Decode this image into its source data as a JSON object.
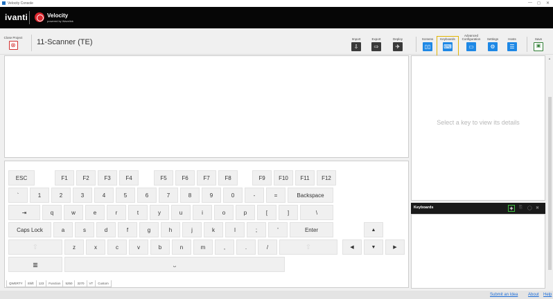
{
  "window": {
    "title": "Velocity Console",
    "controls": [
      "—",
      "◻",
      "✕"
    ]
  },
  "brand": {
    "vendor": "ivanti",
    "product": "Velocity",
    "subtitle": "powered by Wavelink"
  },
  "toolbar": {
    "close_project": "Close Project",
    "project_title": "11-Scanner (TE)",
    "buttons": {
      "import": "Import",
      "export": "Export",
      "deploy": "Deploy",
      "screens": "Screens",
      "keyboards": "Keyboards",
      "advanced_configuration": "Advanced\nConfiguration",
      "settings": "Settings",
      "hosts": "Hosts",
      "save": "Save"
    },
    "selected": "keyboards",
    "colors": {
      "accent_blue": "#1e88e5",
      "selected_outline": "#e0b400",
      "save_green": "#2e7d32"
    }
  },
  "details": {
    "message": "Select a key to view its details"
  },
  "keyboard": {
    "row1": [
      "ESC",
      "F1",
      "F2",
      "F3",
      "F4",
      "F5",
      "F6",
      "F7",
      "F8",
      "F9",
      "F10",
      "F11",
      "F12"
    ],
    "row2": [
      "`",
      "1",
      "2",
      "3",
      "4",
      "5",
      "6",
      "7",
      "8",
      "9",
      "0",
      "-",
      "=",
      "Backspace"
    ],
    "row3": [
      "⇥",
      "q",
      "w",
      "e",
      "r",
      "t",
      "y",
      "u",
      "i",
      "o",
      "p",
      "[",
      "]",
      "\\"
    ],
    "row4": [
      "Caps Lock",
      "a",
      "s",
      "d",
      "f",
      "g",
      "h",
      "j",
      "k",
      "l",
      ";",
      "'",
      "Enter",
      "▲"
    ],
    "row5": [
      "⇧",
      "z",
      "x",
      "c",
      "v",
      "b",
      "n",
      "m",
      ",",
      ".",
      "/",
      "⇧",
      "◀",
      "▼",
      "▶"
    ],
    "row6": [
      "▥",
      "⎵"
    ],
    "tabs": [
      "QWERTY",
      "Shift",
      "123",
      "Function",
      "5250",
      "3270",
      "VT",
      "Custom"
    ],
    "active_tab": "QWERTY"
  },
  "keyboards_panel": {
    "title": "Keyboards",
    "add_icon": "+",
    "icons": [
      "⎘",
      "◯",
      "✖"
    ]
  },
  "footer": {
    "links": [
      "Submit an Idea",
      "About",
      "Help"
    ]
  }
}
